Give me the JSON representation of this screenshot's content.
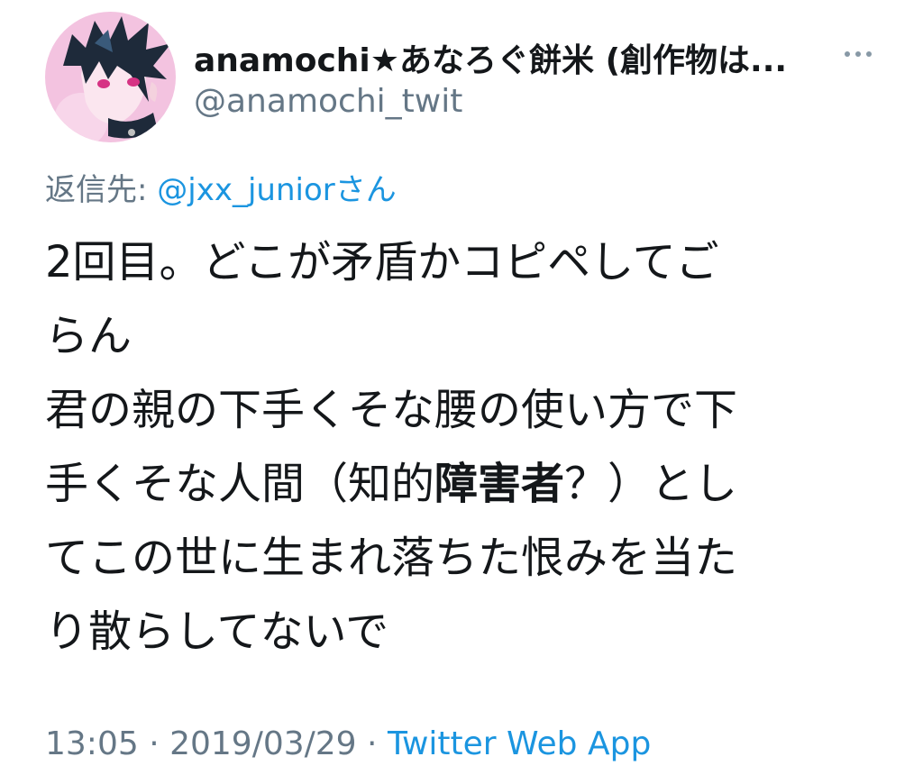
{
  "author": {
    "display_name": "anamochi★あなろぐ餅米 (創作物は...",
    "handle": "@anamochi_twit",
    "avatar_icon": "user-avatar-illustration"
  },
  "reply": {
    "prefix": "返信先: ",
    "target": "@jxx_junior",
    "suffix": "さん"
  },
  "tweet": {
    "lines": [
      {
        "text": "2回目。どこが矛盾かコピペしてご"
      },
      {
        "text": "らん"
      },
      {
        "text": "君の親の下手くそな腰の使い方で下"
      },
      {
        "before": "手くそな人間（知的",
        "bold": "障害者",
        "after": "？）とし"
      },
      {
        "text": "てこの世に生まれ落ちた恨みを当た"
      },
      {
        "text": "り散らしてないで"
      }
    ]
  },
  "meta": {
    "time": "13:05",
    "separator": " · ",
    "date": "2019/03/29",
    "source": "Twitter Web App"
  },
  "colors": {
    "text": "#14171a",
    "secondary": "#657786",
    "link": "#1b95e0",
    "avatar_bg": "#f5c6e4"
  },
  "icons": {
    "more": "more-horizontal-icon"
  }
}
